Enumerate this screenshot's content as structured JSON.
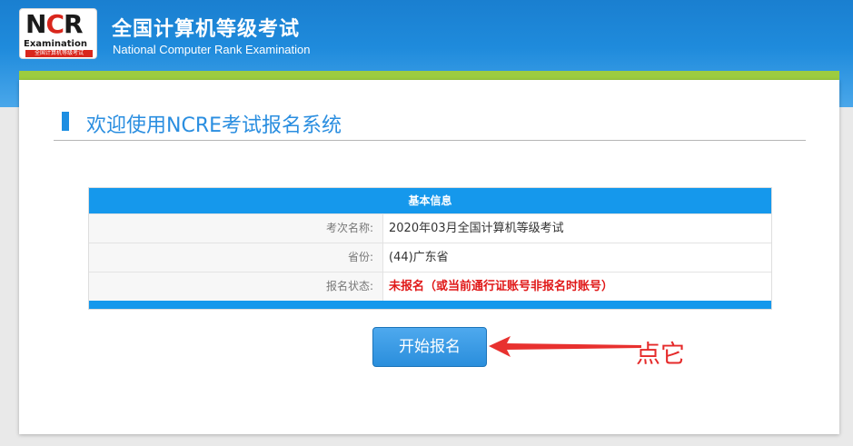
{
  "header": {
    "logo": {
      "letters_n": "N",
      "letters_c": "C",
      "letters_r": "R",
      "word": "Examination",
      "sub": "全国计算机等级考试"
    },
    "title_cn": "全国计算机等级考试",
    "title_en": "National Computer Rank Examination"
  },
  "main": {
    "page_title": "欢迎使用NCRE考试报名系统",
    "info_table": {
      "header": "基本信息",
      "rows": [
        {
          "label": "考次名称:",
          "value": "2020年03月全国计算机等级考试"
        },
        {
          "label": "省份:",
          "value": "(44)广东省"
        },
        {
          "label": "报名状态:",
          "value": "未报名（或当前通行证账号非报名时账号）"
        }
      ]
    },
    "start_button_label": "开始报名",
    "annotation": "点它"
  },
  "colors": {
    "header_blue": "#1f8bdc",
    "accent_green": "#9dcc3f",
    "table_blue": "#1598ec",
    "status_red": "#e01818",
    "annotation_red": "#e52a2a"
  },
  "icons": [
    "ncre-logo",
    "arrow-pointer-icon"
  ]
}
